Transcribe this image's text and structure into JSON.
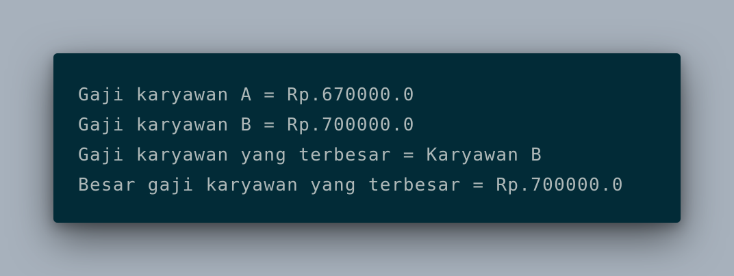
{
  "terminal": {
    "lines": [
      "Gaji karyawan A = Rp.670000.0",
      "Gaji karyawan B = Rp.700000.0",
      "Gaji karyawan yang terbesar = Karyawan B",
      "Besar gaji karyawan yang terbesar = Rp.700000.0"
    ]
  },
  "colors": {
    "page_background": "#a7b1bc",
    "terminal_background": "#022b37",
    "terminal_text": "#aeb8b8"
  }
}
